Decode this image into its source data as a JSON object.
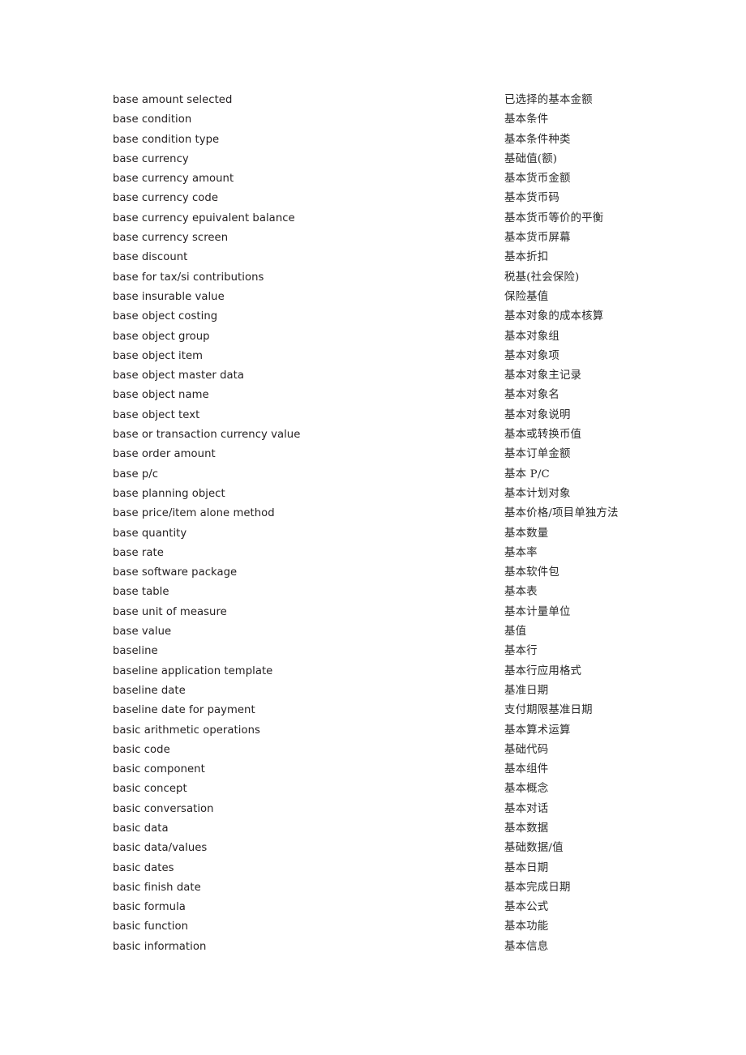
{
  "document": {
    "type": "bilingual-glossary",
    "background_color": "#ffffff",
    "text_color": "#231f20",
    "source_language": "English",
    "target_language": "Chinese"
  },
  "entries": [
    {
      "term": "base amount selected",
      "gloss": "已选择的基本金额"
    },
    {
      "term": "base condition",
      "gloss": "基本条件"
    },
    {
      "term": "base condition type",
      "gloss": "基本条件种类"
    },
    {
      "term": "base currency",
      "gloss": "基础值(额)"
    },
    {
      "term": "base currency amount",
      "gloss": "基本货币金额"
    },
    {
      "term": "base currency code",
      "gloss": "基本货币码"
    },
    {
      "term": "base currency epuivalent balance",
      "gloss": "基本货币等价的平衡"
    },
    {
      "term": "base currency screen",
      "gloss": "基本货币屏幕"
    },
    {
      "term": "base discount",
      "gloss": "基本折扣"
    },
    {
      "term": "base for tax/si contributions",
      "gloss": "税基(社会保险)"
    },
    {
      "term": "base insurable value",
      "gloss": "保险基值"
    },
    {
      "term": "base object costing",
      "gloss": "基本对象的成本核算"
    },
    {
      "term": "base object group",
      "gloss": "基本对象组"
    },
    {
      "term": "base object item",
      "gloss": "基本对象项"
    },
    {
      "term": "base object master data",
      "gloss": "基本对象主记录"
    },
    {
      "term": "base object name",
      "gloss": "基本对象名"
    },
    {
      "term": "base object text",
      "gloss": "基本对象说明"
    },
    {
      "term": "base or transaction currency value",
      "gloss": "基本或转换币值"
    },
    {
      "term": "base order amount",
      "gloss": "基本订单金额"
    },
    {
      "term": "base p/c",
      "gloss": "基本 P/C"
    },
    {
      "term": "base planning object",
      "gloss": "基本计划对象"
    },
    {
      "term": "base price/item alone method",
      "gloss": "基本价格/项目单独方法"
    },
    {
      "term": "base quantity",
      "gloss": "基本数量"
    },
    {
      "term": "base rate",
      "gloss": "基本率"
    },
    {
      "term": "base software package",
      "gloss": "基本软件包"
    },
    {
      "term": "base table",
      "gloss": "基本表"
    },
    {
      "term": "base unit of measure",
      "gloss": "基本计量单位"
    },
    {
      "term": "base value",
      "gloss": "基值"
    },
    {
      "term": "baseline",
      "gloss": "基本行"
    },
    {
      "term": "baseline application template",
      "gloss": "基本行应用格式"
    },
    {
      "term": "baseline date",
      "gloss": "基准日期"
    },
    {
      "term": "baseline date for payment",
      "gloss": "支付期限基准日期"
    },
    {
      "term": "basic arithmetic operations",
      "gloss": "基本算术运算"
    },
    {
      "term": "basic code",
      "gloss": "基础代码"
    },
    {
      "term": "basic component",
      "gloss": "基本组件"
    },
    {
      "term": "basic concept",
      "gloss": "基本概念"
    },
    {
      "term": "basic conversation",
      "gloss": "基本对话"
    },
    {
      "term": "basic data",
      "gloss": "基本数据"
    },
    {
      "term": "basic data/values",
      "gloss": "基础数据/值"
    },
    {
      "term": "basic dates",
      "gloss": "基本日期"
    },
    {
      "term": "basic finish date",
      "gloss": "基本完成日期"
    },
    {
      "term": "basic formula",
      "gloss": "基本公式"
    },
    {
      "term": "basic function",
      "gloss": "基本功能"
    },
    {
      "term": "basic information",
      "gloss": "基本信息"
    }
  ]
}
